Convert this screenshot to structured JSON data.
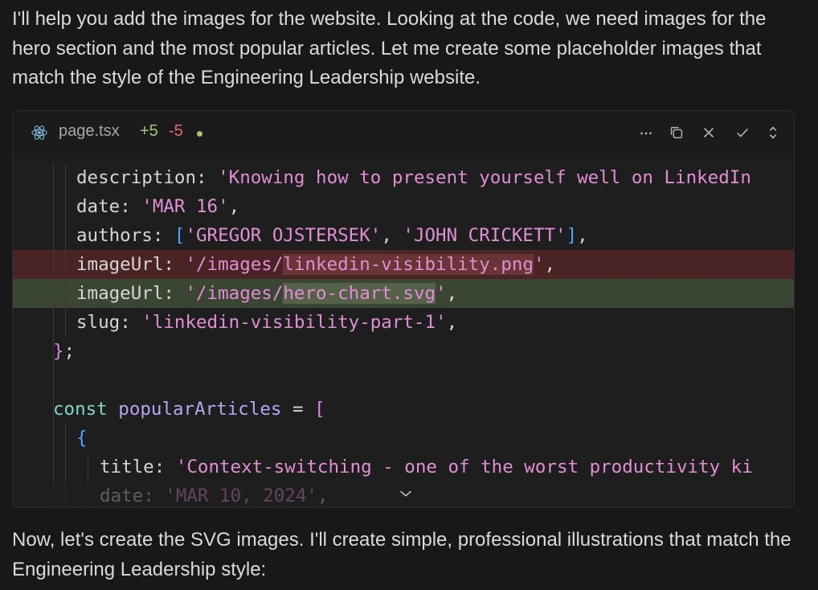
{
  "message_top": "I'll help you add the images for the website. Looking at the code, we need images for the hero section and the most popular articles. Let me create some placeholder images that match the style of the Engineering Leadership website.",
  "message_bottom": "Now, let's create the SVG images. I'll create simple, professional illustrations that match the Engineering Leadership style:",
  "editor": {
    "file_icon": "react-icon",
    "file_name": "page.tsx",
    "added": "+5",
    "removed": "-5",
    "actions": [
      "more-icon",
      "copy-icon",
      "reject-icon",
      "accept-icon",
      "expand-collapse-icon"
    ],
    "lines": {
      "l1": {
        "prop": "description",
        "sep": ": ",
        "str": "'Knowing how to present yourself well on LinkedIn"
      },
      "l2": {
        "prop": "date",
        "sep": ": ",
        "str": "'MAR 16'",
        "end": ","
      },
      "l3": {
        "prop": "authors",
        "sep": ": ",
        "open": "[",
        "s1": "'GREGOR OJSTERSEK'",
        "mid": ", ",
        "s2": "'JOHN CRICKETT'",
        "close": "]",
        "end": ","
      },
      "l4": {
        "prop": "imageUrl",
        "sep": ": ",
        "pre": "'/images/",
        "hl": "linkedin-visibility.png",
        "post": "'",
        "end": ","
      },
      "l5": {
        "prop": "imageUrl",
        "sep": ": ",
        "pre": "'/images/",
        "hl": "hero-chart.svg",
        "post": "'",
        "end": ","
      },
      "l6": {
        "prop": "slug",
        "sep": ": ",
        "str": "'linkedin-visibility-part-1'",
        "end": ","
      },
      "l7": {
        "brace": "}",
        "end": ";"
      },
      "l9": {
        "kw": "const",
        "var": "popularArticles",
        "eq": " = ",
        "open": "["
      },
      "l10": {
        "brace": "{"
      },
      "l11": {
        "prop": "title",
        "sep": ": ",
        "str": "'Context-switching - one of the worst productivity ki"
      },
      "l12": {
        "prop": "date",
        "sep": ": ",
        "str": "'MAR 10, 2024'",
        "end": ","
      }
    },
    "scroll_icon": "chevron-down-icon"
  }
}
